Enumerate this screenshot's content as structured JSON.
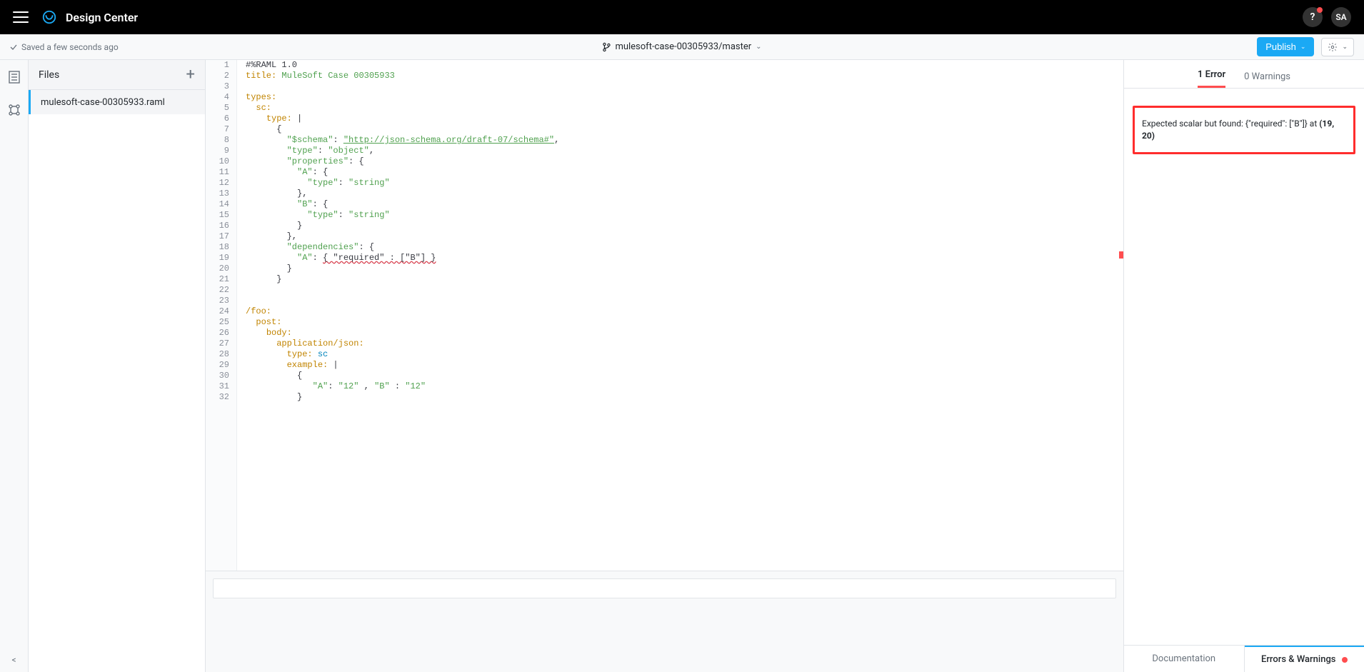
{
  "header": {
    "app_title": "Design Center",
    "user_initials": "SA",
    "help_glyph": "?"
  },
  "toolbar": {
    "save_status": "Saved a few seconds ago",
    "branch_label": "mulesoft-case-00305933/master",
    "publish_label": "Publish"
  },
  "files": {
    "heading": "Files",
    "items": [
      {
        "name": "mulesoft-case-00305933.raml"
      }
    ]
  },
  "editor": {
    "lines": [
      {
        "n": 1,
        "segs": [
          [
            "meta",
            "#%RAML 1.0"
          ]
        ]
      },
      {
        "n": 2,
        "segs": [
          [
            "key",
            "title:"
          ],
          [
            "",
            ""
          ],
          [
            "str",
            " MuleSoft Case 00305933"
          ]
        ]
      },
      {
        "n": 3,
        "segs": [
          [
            "",
            ""
          ]
        ]
      },
      {
        "n": 4,
        "segs": [
          [
            "key",
            "types:"
          ]
        ]
      },
      {
        "n": 5,
        "segs": [
          [
            "",
            "  "
          ],
          [
            "key",
            "sc:"
          ]
        ]
      },
      {
        "n": 6,
        "segs": [
          [
            "",
            "    "
          ],
          [
            "key",
            "type:"
          ],
          [
            "",
            " |"
          ]
        ]
      },
      {
        "n": 7,
        "segs": [
          [
            "",
            "      {"
          ]
        ]
      },
      {
        "n": 8,
        "segs": [
          [
            "",
            "        "
          ],
          [
            "str",
            "\"$schema\""
          ],
          [
            "punc",
            ": "
          ],
          [
            "strlink",
            "\"http://json-schema.org/draft-07/schema#\""
          ],
          [
            "punc",
            ","
          ]
        ]
      },
      {
        "n": 9,
        "segs": [
          [
            "",
            "        "
          ],
          [
            "str",
            "\"type\""
          ],
          [
            "punc",
            ": "
          ],
          [
            "str",
            "\"object\""
          ],
          [
            "punc",
            ","
          ]
        ]
      },
      {
        "n": 10,
        "segs": [
          [
            "",
            "        "
          ],
          [
            "str",
            "\"properties\""
          ],
          [
            "punc",
            ": {"
          ]
        ]
      },
      {
        "n": 11,
        "segs": [
          [
            "",
            "          "
          ],
          [
            "str",
            "\"A\""
          ],
          [
            "punc",
            ": {"
          ]
        ]
      },
      {
        "n": 12,
        "segs": [
          [
            "",
            "            "
          ],
          [
            "str",
            "\"type\""
          ],
          [
            "punc",
            ": "
          ],
          [
            "str",
            "\"string\""
          ]
        ]
      },
      {
        "n": 13,
        "segs": [
          [
            "",
            "          },"
          ]
        ]
      },
      {
        "n": 14,
        "segs": [
          [
            "",
            "          "
          ],
          [
            "str",
            "\"B\""
          ],
          [
            "punc",
            ": {"
          ]
        ]
      },
      {
        "n": 15,
        "segs": [
          [
            "",
            "            "
          ],
          [
            "str",
            "\"type\""
          ],
          [
            "punc",
            ": "
          ],
          [
            "str",
            "\"string\""
          ]
        ]
      },
      {
        "n": 16,
        "segs": [
          [
            "",
            "          }"
          ]
        ]
      },
      {
        "n": 17,
        "segs": [
          [
            "",
            "        },"
          ]
        ]
      },
      {
        "n": 18,
        "segs": [
          [
            "",
            "        "
          ],
          [
            "str",
            "\"dependencies\""
          ],
          [
            "punc",
            ": {"
          ]
        ]
      },
      {
        "n": 19,
        "segs": [
          [
            "",
            "          "
          ],
          [
            "str",
            "\"A\""
          ],
          [
            "",
            ": "
          ],
          [
            "err",
            "{ \"required\" : [\"B\"] }"
          ]
        ]
      },
      {
        "n": 20,
        "segs": [
          [
            "",
            "        }"
          ]
        ]
      },
      {
        "n": 21,
        "segs": [
          [
            "",
            "      }"
          ]
        ]
      },
      {
        "n": 22,
        "segs": [
          [
            "",
            ""
          ]
        ]
      },
      {
        "n": 23,
        "segs": [
          [
            "",
            ""
          ]
        ]
      },
      {
        "n": 24,
        "segs": [
          [
            "key",
            "/foo:"
          ]
        ]
      },
      {
        "n": 25,
        "segs": [
          [
            "",
            "  "
          ],
          [
            "key",
            "post:"
          ]
        ]
      },
      {
        "n": 26,
        "segs": [
          [
            "",
            "    "
          ],
          [
            "key",
            "body:"
          ]
        ]
      },
      {
        "n": 27,
        "segs": [
          [
            "",
            "      "
          ],
          [
            "key",
            "application/json:"
          ]
        ]
      },
      {
        "n": 28,
        "segs": [
          [
            "",
            "        "
          ],
          [
            "key",
            "type:"
          ],
          [
            "",
            ""
          ],
          [
            "type",
            " sc"
          ]
        ]
      },
      {
        "n": 29,
        "segs": [
          [
            "",
            "        "
          ],
          [
            "key",
            "example:"
          ],
          [
            "",
            " |"
          ]
        ]
      },
      {
        "n": 30,
        "segs": [
          [
            "",
            "          {"
          ]
        ]
      },
      {
        "n": 31,
        "segs": [
          [
            "",
            "             "
          ],
          [
            "str",
            "\"A\""
          ],
          [
            "punc",
            ": "
          ],
          [
            "str",
            "\"12\""
          ],
          [
            "punc",
            " , "
          ],
          [
            "str",
            "\"B\""
          ],
          [
            "punc",
            " : "
          ],
          [
            "str",
            "\"12\""
          ]
        ]
      },
      {
        "n": 32,
        "segs": [
          [
            "",
            "          }"
          ]
        ]
      }
    ]
  },
  "problems": {
    "error_tab": "1 Error",
    "warning_tab": "0 Warnings",
    "error_text_prefix": "Expected scalar but found: {\"required\": [\"B\"]} at ",
    "error_loc": "(19, 20)"
  },
  "bottom_tabs": {
    "documentation": "Documentation",
    "errors_warnings": "Errors & Warnings"
  },
  "icons": {
    "collapse": "<"
  }
}
